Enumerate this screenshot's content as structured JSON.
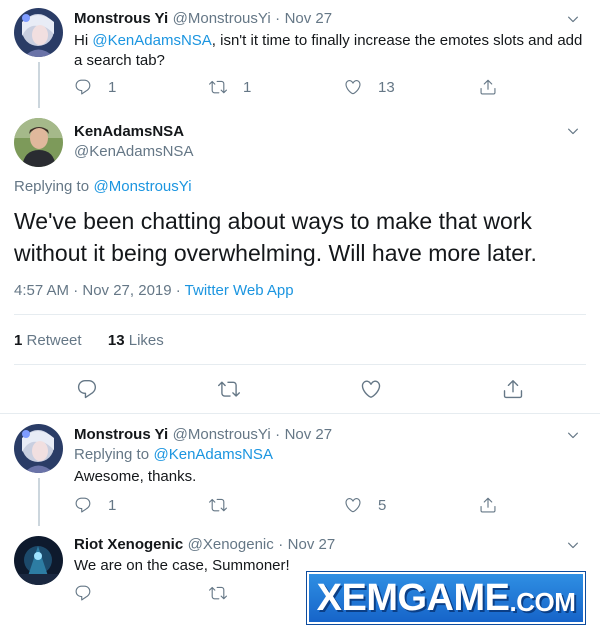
{
  "tweet1": {
    "name": "Monstrous Yi",
    "handle": "@MonstrousYi",
    "dot": "·",
    "date": "Nov 27",
    "text_before": "Hi ",
    "mention": "@KenAdamsNSA",
    "text_after": ", isn't it time to finally increase the emotes slots and add",
    "text_line2": "a search tab?",
    "replies": "1",
    "retweets": "1",
    "likes": "13"
  },
  "main_tweet": {
    "name": "KenAdamsNSA",
    "handle": "@KenAdamsNSA",
    "replying_label": "Replying to",
    "replying_to": "@MonstrousYi",
    "text_line1": "We've been chatting about ways to make that work",
    "text_line2": "without it being overwhelming. Will have more later.",
    "timestamp": "4:57 AM · Nov 27, 2019 · ",
    "source": "Twitter Web App",
    "retweet_count": "1",
    "retweet_label": "Retweet",
    "like_count": "13",
    "like_label": "Likes"
  },
  "reply1": {
    "name": "Monstrous Yi",
    "handle": "@MonstrousYi",
    "dot": "·",
    "date": "Nov 27",
    "replying_label": "Replying to",
    "replying_to": "@KenAdamsNSA",
    "text": "Awesome, thanks.",
    "replies": "1",
    "likes": "5"
  },
  "reply2": {
    "name": "Riot Xenogenic",
    "handle": "@Xenogenic",
    "dot": "·",
    "date": "Nov 27",
    "text": "We are on the case, Summoner!"
  },
  "watermark": {
    "main": "XEMGAME",
    "tld": ".COM"
  },
  "icons": {
    "reply": "reply-icon",
    "retweet": "retweet-icon",
    "like": "heart-icon",
    "share": "share-icon",
    "caret": "chevron-down-icon"
  },
  "colors": {
    "link": "#1b95e0",
    "muted": "#657786",
    "divider": "#e6ecf0"
  }
}
